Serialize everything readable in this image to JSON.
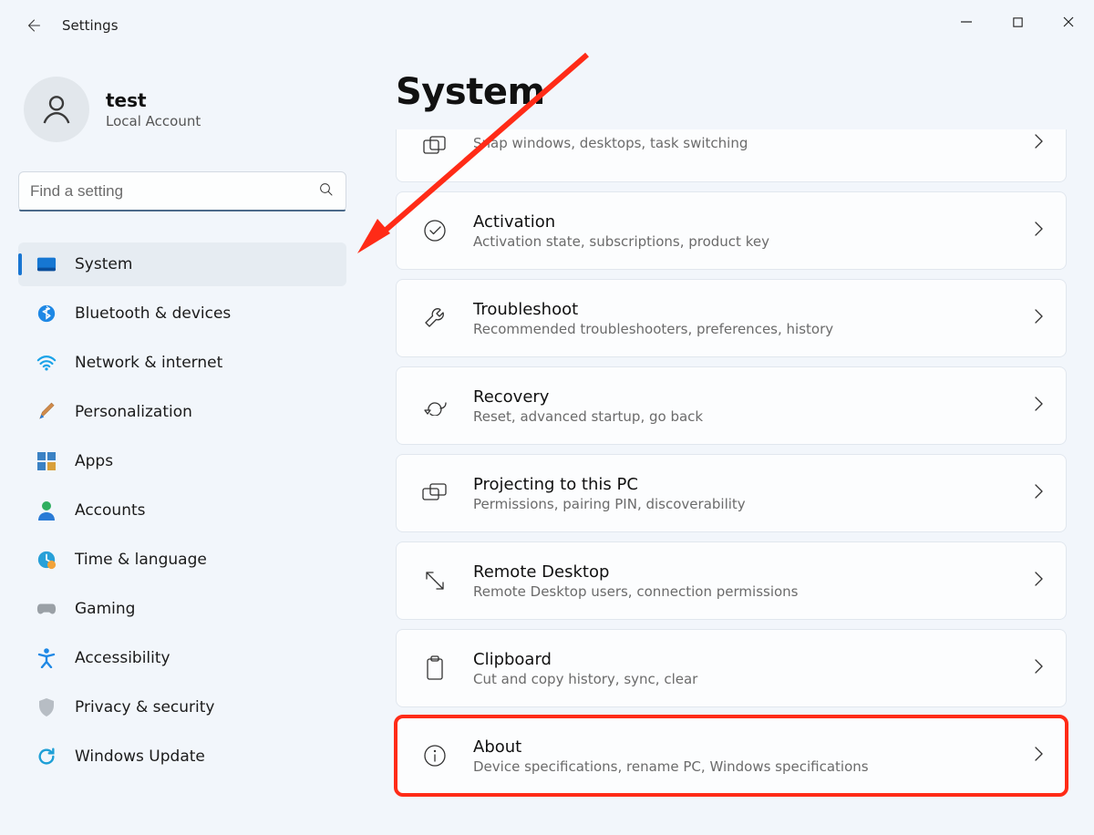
{
  "window": {
    "title": "Settings"
  },
  "account": {
    "name": "test",
    "type": "Local Account"
  },
  "search": {
    "placeholder": "Find a setting"
  },
  "nav": {
    "items": [
      {
        "label": "System"
      },
      {
        "label": "Bluetooth & devices"
      },
      {
        "label": "Network & internet"
      },
      {
        "label": "Personalization"
      },
      {
        "label": "Apps"
      },
      {
        "label": "Accounts"
      },
      {
        "label": "Time & language"
      },
      {
        "label": "Gaming"
      },
      {
        "label": "Accessibility"
      },
      {
        "label": "Privacy & security"
      },
      {
        "label": "Windows Update"
      }
    ]
  },
  "page": {
    "title": "System"
  },
  "cards": [
    {
      "title": "",
      "sub": "Snap windows, desktops, task switching"
    },
    {
      "title": "Activation",
      "sub": "Activation state, subscriptions, product key"
    },
    {
      "title": "Troubleshoot",
      "sub": "Recommended troubleshooters, preferences, history"
    },
    {
      "title": "Recovery",
      "sub": "Reset, advanced startup, go back"
    },
    {
      "title": "Projecting to this PC",
      "sub": "Permissions, pairing PIN, discoverability"
    },
    {
      "title": "Remote Desktop",
      "sub": "Remote Desktop users, connection permissions"
    },
    {
      "title": "Clipboard",
      "sub": "Cut and copy history, sync, clear"
    },
    {
      "title": "About",
      "sub": "Device specifications, rename PC, Windows specifications"
    }
  ]
}
